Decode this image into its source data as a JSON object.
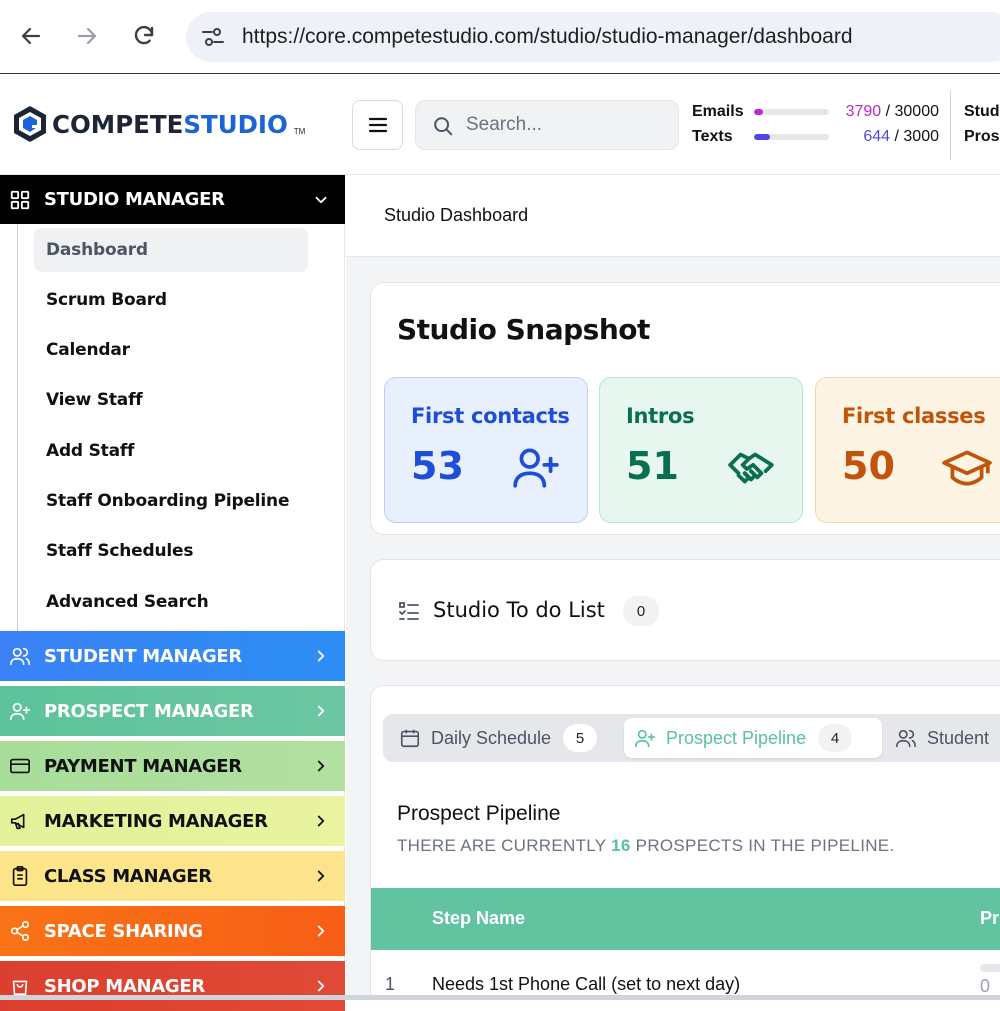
{
  "browser": {
    "url": "https://core.competestudio.com/studio/studio-manager/dashboard"
  },
  "header": {
    "logo_prefix": "COMPETE",
    "logo_accent": "STUDIO",
    "logo_tm": "TM",
    "search_placeholder": "Search...",
    "usage": [
      {
        "label": "Emails",
        "used": "3790",
        "sep": " / ",
        "limit": "30000",
        "fraction": 0.126,
        "color": "#c026d3"
      },
      {
        "label": "Texts",
        "used": "644",
        "sep": " / ",
        "limit": "3000",
        "fraction": 0.215,
        "color": "#4f46e5"
      }
    ],
    "cut_labels": [
      "Stud",
      "Prosp"
    ]
  },
  "sidebar": {
    "studio_manager": {
      "label": "STUDIO MANAGER",
      "items": [
        "Dashboard",
        "Scrum Board",
        "Calendar",
        "View Staff",
        "Add Staff",
        "Staff Onboarding Pipeline",
        "Staff Schedules",
        "Advanced Search"
      ],
      "active": "Dashboard"
    },
    "managers": [
      {
        "label": "STUDENT MANAGER",
        "color": "#3b82f6",
        "gradient_to": "#2c8ef4",
        "text": "#ffffff",
        "icon": "users-icon"
      },
      {
        "label": "PROSPECT MANAGER",
        "color": "#5cc39b",
        "gradient_to": "#6dc6a3",
        "text": "#ffffff",
        "icon": "user-plus-icon"
      },
      {
        "label": "PAYMENT MANAGER",
        "color": "#a8dd9a",
        "gradient_to": "#b2e0a0",
        "text": "#111111",
        "icon": "credit-card-icon"
      },
      {
        "label": "MARKETING MANAGER",
        "color": "#e2f29a",
        "gradient_to": "#e9f3a0",
        "text": "#111111",
        "icon": "megaphone-icon"
      },
      {
        "label": "CLASS MANAGER",
        "color": "#fde68a",
        "gradient_to": "#fde38c",
        "text": "#111111",
        "icon": "clipboard-icon"
      },
      {
        "label": "SPACE SHARING",
        "color": "#f97316",
        "gradient_to": "#f75e16",
        "text": "#ffffff",
        "icon": "share-icon"
      },
      {
        "label": "SHOP MANAGER",
        "color": "#dc3f2f",
        "gradient_to": "#e04a36",
        "text": "#ffffff",
        "icon": "shopping-bag-icon"
      }
    ]
  },
  "main": {
    "breadcrumb": "Studio Dashboard",
    "snapshot": {
      "title": "Studio Snapshot",
      "stats": [
        {
          "label": "First contacts",
          "value": "53",
          "bg": "#e8f0fd",
          "border": "#bcd0f5",
          "color": "#1d4ed8",
          "icon": "user-plus-icon"
        },
        {
          "label": "Intros",
          "value": "51",
          "bg": "#e7f7f0",
          "border": "#b7e6d1",
          "color": "#08704f",
          "icon": "handshake-icon"
        },
        {
          "label": "First classes",
          "value": "50",
          "bg": "#fef4e4",
          "border": "#f5d7a6",
          "color": "#c2540a",
          "icon": "graduation-cap-icon"
        }
      ]
    },
    "todo": {
      "title": "Studio To do List",
      "count": "0"
    },
    "tabs": [
      {
        "label": "Daily Schedule",
        "count": "5",
        "active": false,
        "icon": "calendar-icon"
      },
      {
        "label": "Prospect Pipeline",
        "count": "4",
        "active": true,
        "icon": "user-plus-icon"
      },
      {
        "label": "Student",
        "count": "",
        "active": false,
        "icon": "users-icon"
      }
    ],
    "pipeline": {
      "title": "Prospect Pipeline",
      "sub_before": "THERE ARE CURRENTLY ",
      "sub_count": "16",
      "sub_after": " PROSPECTS IN THE PIPELINE.",
      "columns": [
        "Step Name",
        "Pr"
      ],
      "rows": [
        {
          "num": "1",
          "step": "Needs 1st Phone Call (set to next day)",
          "extra": "0"
        }
      ]
    }
  }
}
